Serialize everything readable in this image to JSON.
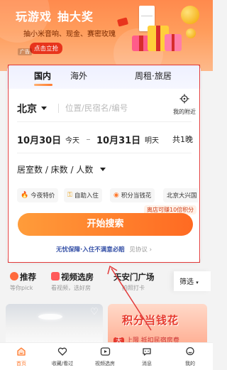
{
  "banner": {
    "title_part1": "玩游戏",
    "title_part2": "抽大奖",
    "subtitle": "抽小米音响、现金、赛密玫瑰",
    "cta": "点击立抢",
    "ad_tag": "广告"
  },
  "tabs": {
    "domestic": "国内",
    "overseas": "海外",
    "rental": "周租·旅居"
  },
  "search": {
    "city": "北京",
    "placeholder": "位置/民宿名/编号",
    "nearby_label": "我的附近"
  },
  "dates": {
    "checkin_date": "10月30日",
    "checkin_day": "今天",
    "checkout_date": "10月31日",
    "checkout_day": "明天",
    "nights": "共1晚"
  },
  "room_selector": "居室数 / 床数 / 人数",
  "chips": [
    {
      "icon": "flame-icon",
      "label": "今夜特价"
    },
    {
      "icon": "key-icon",
      "label": "自助入住"
    },
    {
      "icon": "coin-icon",
      "label": "积分当钱花"
    },
    {
      "icon": "",
      "label": "北京大兴国"
    }
  ],
  "coupon_tag": "离店可赚10倍积分",
  "search_button": "开始搜索",
  "guarantee": {
    "brand": "无忧保障",
    "text": "·入住不满意必赔",
    "link": "见协议"
  },
  "categories": [
    {
      "title": "推荐",
      "sub": "等你pick",
      "color": "#ff6a3d"
    },
    {
      "title": "视频选房",
      "sub": "看视频，选好房",
      "color": "#ff5a5a"
    },
    {
      "title": "天安门广场",
      "sub": "拍照打卡",
      "color": ""
    }
  ],
  "filter_label": "筛选",
  "cards": {
    "right_title": "积分当钱花",
    "right_pill": "天",
    "right_sub": "上限 抵扣民宿房费"
  },
  "nav": [
    {
      "label": "首页",
      "icon": "home-icon",
      "active": true
    },
    {
      "label": "收藏/看过",
      "icon": "heart-icon",
      "active": false
    },
    {
      "label": "视频选房",
      "icon": "video-icon",
      "active": false
    },
    {
      "label": "消息",
      "icon": "message-icon",
      "active": false
    },
    {
      "label": "我的",
      "icon": "profile-icon",
      "active": false
    }
  ],
  "colors": {
    "accent": "#ff7a2e",
    "annotation": "#e23a3a",
    "link_blue": "#3853a8"
  }
}
